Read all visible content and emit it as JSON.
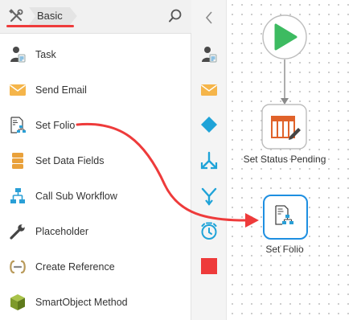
{
  "header": {
    "breadcrumb": "Basic",
    "tools_icon": "tools-icon",
    "search_icon": "search-icon"
  },
  "toolbox": {
    "items": [
      {
        "label": "Task",
        "icon": "task-user-icon"
      },
      {
        "label": "Send Email",
        "icon": "envelope-icon"
      },
      {
        "label": "Set Folio",
        "icon": "set-folio-icon"
      },
      {
        "label": "Set Data Fields",
        "icon": "data-fields-icon"
      },
      {
        "label": "Call Sub Workflow",
        "icon": "sub-workflow-icon"
      },
      {
        "label": "Placeholder",
        "icon": "wrench-icon"
      },
      {
        "label": "Create Reference",
        "icon": "reference-icon"
      },
      {
        "label": "SmartObject Method",
        "icon": "smartobject-cube-icon"
      }
    ]
  },
  "strip": {
    "collapse_icon": "chevron-left-icon",
    "icons": [
      "task-user-icon",
      "envelope-icon",
      "decision-diamond-icon",
      "split-icon",
      "merge-icon",
      "timer-icon",
      "end-square-icon"
    ]
  },
  "canvas": {
    "start_node": {
      "icon": "play-icon"
    },
    "nodes": [
      {
        "label": "Set Status Pending",
        "icon": "table-edit-icon",
        "selected": false
      },
      {
        "label": "Set Folio",
        "icon": "set-folio-icon",
        "selected": true
      }
    ]
  },
  "colors": {
    "accent_red": "#ee3b3b",
    "start_green": "#3dbb61",
    "selected_blue": "#1e8fe1",
    "status_orange": "#e0622a",
    "end_red": "#ee3b3b"
  }
}
